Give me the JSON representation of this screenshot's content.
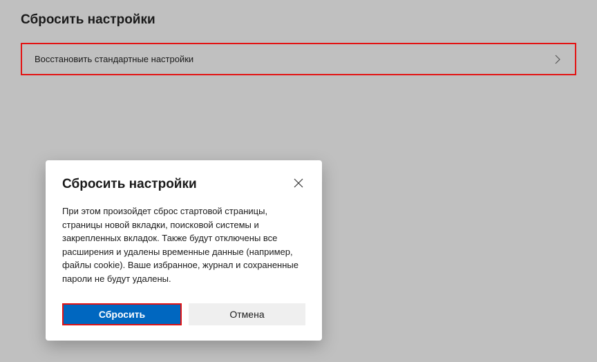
{
  "page": {
    "title": "Сбросить настройки"
  },
  "settingsRow": {
    "label": "Восстановить стандартные настройки"
  },
  "dialog": {
    "title": "Сбросить настройки",
    "body": "При этом произойдет сброс стартовой страницы, страницы новой вкладки, поисковой системы и закрепленных вкладок. Также будут отключены все расширения и удалены временные данные (например, файлы cookie). Ваше избранное, журнал и сохраненные пароли не будут удалены.",
    "primaryButton": "Сбросить",
    "secondaryButton": "Отмена"
  }
}
